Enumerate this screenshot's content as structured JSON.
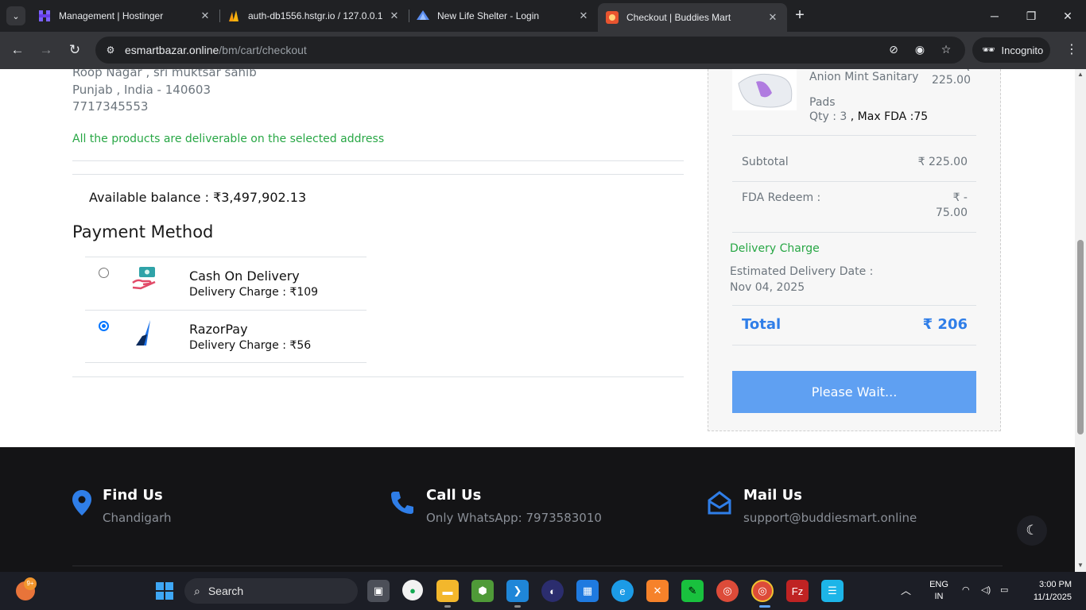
{
  "browser": {
    "tabs": [
      {
        "title": "Management | Hostinger",
        "icon": "hostinger-icon"
      },
      {
        "title": "auth-db1556.hstgr.io / 127.0.0.1",
        "icon": "phpmyadmin-icon"
      },
      {
        "title": "New Life Shelter - Login",
        "icon": "shelter-icon"
      },
      {
        "title": "Checkout | Buddies Mart",
        "icon": "buddies-mart-icon"
      }
    ],
    "url_host": "esmartbazar.online",
    "url_path": "/bm/cart/checkout",
    "incognito_label": "Incognito"
  },
  "address": {
    "line1": "Roop Nagar , sri muktsar sahib",
    "line2": "Punjab , India - 140603",
    "phone": "7717345553",
    "deliverable_note": "All the products are deliverable on the selected address"
  },
  "balance": "Available balance : ₹3,497,902.13",
  "payment": {
    "title": "Payment Method",
    "methods": [
      {
        "name": "Cash On Delivery",
        "charge": "Delivery Charge : ₹109",
        "selected": false
      },
      {
        "name": "RazorPay",
        "charge": "Delivery Charge : ₹56",
        "selected": true
      }
    ]
  },
  "summary": {
    "product_name_1": "Anion Mint Sanitary",
    "product_name_2": "Pads",
    "product_price": "225.00",
    "product_price_prefix": "₹",
    "qty": "Qty : 3",
    "max_fda": " , Max FDA :75",
    "subtotal_label": "Subtotal",
    "subtotal_value": "₹ 225.00",
    "fda_label": "FDA Redeem :",
    "fda_value_1": "₹ -",
    "fda_value_2": "75.00",
    "delivery_charge_label": "Delivery Charge",
    "est_label": "Estimated Delivery Date :",
    "est_date": "Nov 04, 2025",
    "total_label": "Total",
    "total_value": "₹ 206",
    "button_label": "Please Wait..."
  },
  "footer": {
    "find_title": "Find Us",
    "find_text": "Chandigarh",
    "call_title": "Call Us",
    "call_text": "Only WhatsApp: 7973583010",
    "mail_title": "Mail Us",
    "mail_text": "support@buddiesmart.online"
  },
  "taskbar": {
    "search_label": "Search",
    "badge": "9+",
    "lang_1": "ENG",
    "lang_2": "IN",
    "time": "3:00 PM",
    "date": "11/1/2025"
  },
  "colors": {
    "accent_blue": "#2f7ee8",
    "button_blue": "#5fa0f2",
    "success_green": "#28a745",
    "footer_bg": "#141416"
  }
}
